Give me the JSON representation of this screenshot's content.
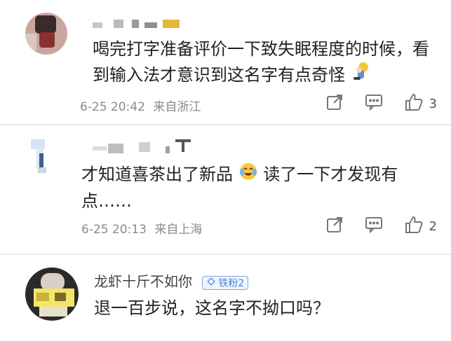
{
  "comments": [
    {
      "username": "",
      "text_line1": "喝完打字准备评价一下致失眠程度的时候，看",
      "text_line2": "到输入法才意识到这名字有点奇怪",
      "emoji": "lightbulb-person",
      "date": "6-25 20:42",
      "location": "来自浙江",
      "likes": "3"
    },
    {
      "username": "",
      "text_part1": "才知道喜茶出了新品",
      "emoji": "crying-laughing",
      "text_part2": "读了一下才发现有",
      "text_line2": "点……",
      "date": "6-25 20:13",
      "location": "来自上海",
      "likes": "2"
    },
    {
      "username": "龙虾十斤不如你",
      "badge": "铁粉2",
      "text": "退一百步说，这名字不拗口吗？"
    }
  ],
  "icons": {
    "share": "share-icon",
    "reply": "comment-icon",
    "like": "thumbs-up-icon",
    "badge": "diamond-icon"
  }
}
